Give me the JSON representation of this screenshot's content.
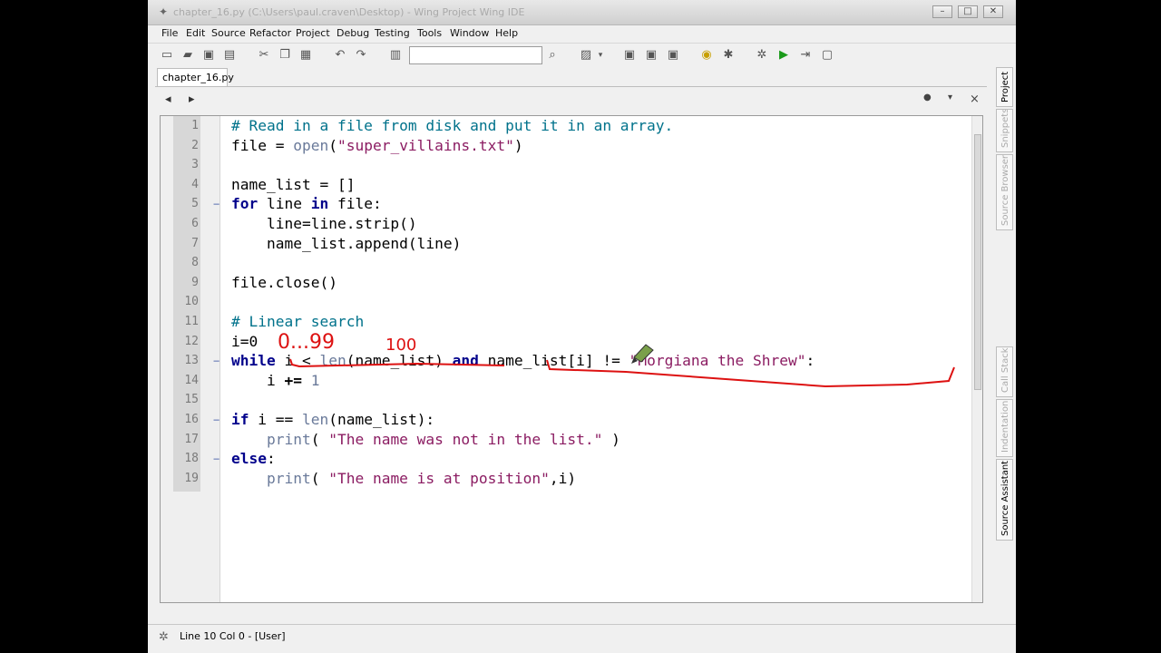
{
  "window": {
    "title": "chapter_16.py (C:\\Users\\paul.craven\\Desktop) - Wing Project Wing IDE",
    "minimize_label": "–",
    "maximize_label": "□",
    "close_label": "✕"
  },
  "menu": [
    "File",
    "Edit",
    "Source",
    "Refactor",
    "Project",
    "Debug",
    "Testing",
    "Tools",
    "Window",
    "Help"
  ],
  "toolbar": {
    "search_value": ""
  },
  "tab": {
    "label": "chapter_16.py"
  },
  "editor": {
    "close_label": "×",
    "line_numbers": [
      "1",
      "2",
      "3",
      "4",
      "5",
      "6",
      "7",
      "8",
      "9",
      "10",
      "11",
      "12",
      "13",
      "14",
      "15",
      "16",
      "17",
      "18",
      "19"
    ]
  },
  "code": {
    "l1_comment": "# Read in a file from disk and put it in an array.",
    "l2_var": "file = ",
    "l2_func": "open",
    "l2_open": "(",
    "l2_str": "\"super_villains.txt\"",
    "l2_close": ")",
    "l4": "name_list = []",
    "l5_kw1": "for",
    "l5_mid": " line ",
    "l5_kw2": "in",
    "l5_end": " file:",
    "l6": "    line=line.strip()",
    "l7": "    name_list.append(line)",
    "l9": "file.close()",
    "l11_comment": "# Linear search",
    "l12": "i=0",
    "l13_kw1": "while",
    "l13_a": " i < ",
    "l13_func": "len",
    "l13_b": "(name_list) ",
    "l13_kw2": "and",
    "l13_c": " name_list[i] != ",
    "l13_str": "\"Morgiana the Shrew\"",
    "l13_d": ":",
    "l14_a": "    i ",
    "l14_op": "+=",
    "l14_b": " 1",
    "l16_kw": "if",
    "l16_a": " i == ",
    "l16_func": "len",
    "l16_b": "(name_list):",
    "l17_a": "    ",
    "l17_func": "print",
    "l17_b": "( ",
    "l17_str": "\"The name was not in the list.\"",
    "l17_c": " )",
    "l18_kw": "else",
    "l18_a": ":",
    "l19_a": "    ",
    "l19_func": "print",
    "l19_b": "( ",
    "l19_str": "\"The name is at position\"",
    "l19_c": ",i)"
  },
  "annotations": {
    "range": "0...99",
    "length": "100"
  },
  "side_tabs": {
    "project": "Project",
    "snippets": "Snippets",
    "source_browser": "Source Browser",
    "call_stack": "Call Stack",
    "indentation": "Indentation",
    "source_assistant": "Source Assistant"
  },
  "status": {
    "text": "Line 10 Col 0 - [User]"
  },
  "icons": {
    "app": "wing-icon",
    "back": "back-arrow-icon",
    "forward": "forward-arrow-icon",
    "options": "options-dot-icon",
    "dropdown": "chevron-down-icon",
    "status": "bug-icon"
  },
  "colors": {
    "comment": "#00728b",
    "keyword": "#00008b",
    "string": "#8b1c62",
    "annotation": "#dd1111"
  }
}
